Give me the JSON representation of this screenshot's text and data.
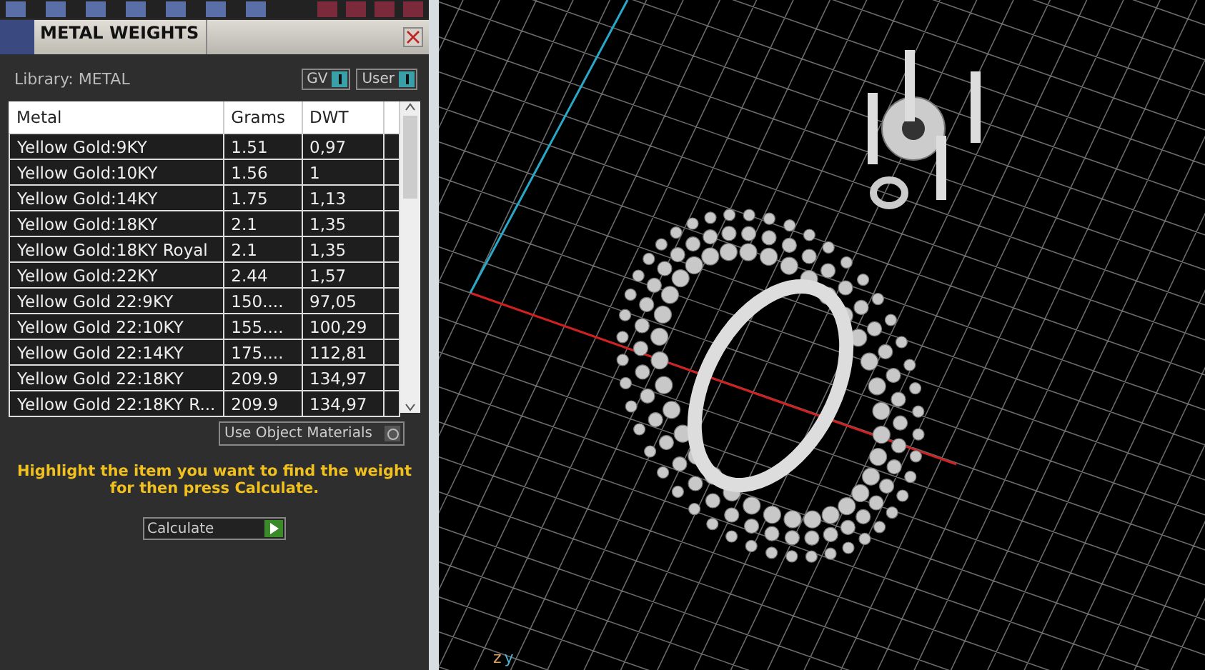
{
  "panel": {
    "title": "METAL WEIGHTS",
    "library_label": "Library: METAL",
    "toggles": [
      {
        "label": "GV",
        "on": true
      },
      {
        "label": "User",
        "on": true
      }
    ],
    "table": {
      "columns": [
        "Metal",
        "Grams",
        "DWT"
      ],
      "rows": [
        [
          "Yellow Gold:9KY",
          "1.51",
          "0,97"
        ],
        [
          "Yellow Gold:10KY",
          "1.56",
          "1"
        ],
        [
          "Yellow Gold:14KY",
          "1.75",
          "1,13"
        ],
        [
          "Yellow Gold:18KY",
          "2.1",
          "1,35"
        ],
        [
          "Yellow Gold:18KY Royal",
          "2.1",
          "1,35"
        ],
        [
          "Yellow Gold:22KY",
          "2.44",
          "1,57"
        ],
        [
          "Yellow Gold 22:9KY",
          "150....",
          "97,05"
        ],
        [
          "Yellow Gold 22:10KY",
          "155....",
          "100,29"
        ],
        [
          "Yellow Gold 22:14KY",
          "175....",
          "112,81"
        ],
        [
          "Yellow Gold 22:18KY",
          "209.9",
          "134,97"
        ],
        [
          "Yellow Gold 22:18KY R...",
          "209.9",
          "134,97"
        ]
      ]
    },
    "use_object_materials": {
      "label": "Use Object Materials",
      "on": false
    },
    "message": "Highlight the item you want to find the weight for then press Calculate.",
    "calculate_button": "Calculate"
  },
  "viewport": {
    "axis_labels": [
      "z",
      "y"
    ]
  }
}
